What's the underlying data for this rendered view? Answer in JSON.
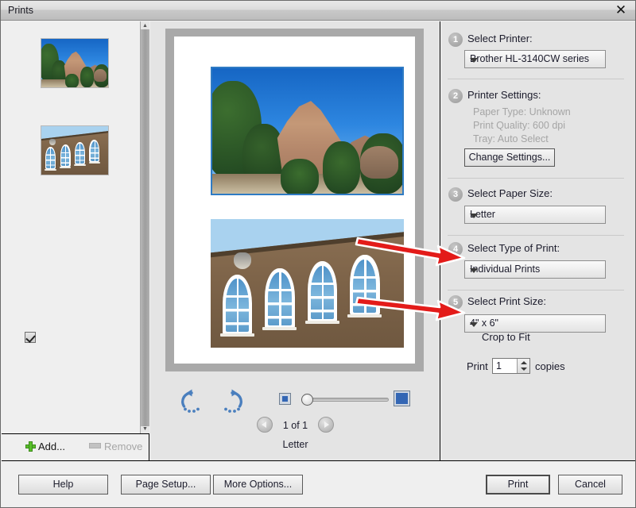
{
  "window": {
    "title": "Prints",
    "close_icon": "close-icon"
  },
  "thumbnails": {
    "items": [
      {
        "alt": "cliff-mesa-photo"
      },
      {
        "alt": "adobe-building-photo"
      }
    ],
    "add_label": "Add...",
    "remove_label": "Remove"
  },
  "preview": {
    "photos": [
      {
        "alt": "cliff-mesa-photo",
        "selected": true
      },
      {
        "alt": "adobe-building-photo",
        "selected": false
      }
    ],
    "rotate_left_icon": "rotate-left-icon",
    "rotate_right_icon": "rotate-right-icon",
    "zoom_out_icon": "zoom-small-icon",
    "zoom_in_icon": "zoom-large-icon",
    "page_indicator": "1 of 1",
    "paper_label": "Letter",
    "prev_icon": "chevron-left-icon",
    "next_icon": "chevron-right-icon"
  },
  "settings": {
    "step1": {
      "number": "1",
      "label": "Select Printer:",
      "value": "Brother HL-3140CW series"
    },
    "step2": {
      "number": "2",
      "label": "Printer Settings:",
      "paper_type": "Paper Type: Unknown",
      "print_quality": "Print Quality: 600 dpi",
      "tray": "Tray: Auto Select",
      "change_button": "Change Settings..."
    },
    "step3": {
      "number": "3",
      "label": "Select Paper Size:",
      "value": "Letter"
    },
    "step4": {
      "number": "4",
      "label": "Select Type of Print:",
      "value": "Individual Prints"
    },
    "step5": {
      "number": "5",
      "label": "Select Print Size:",
      "value": "4\" x 6\"",
      "crop_label": "Crop to Fit",
      "crop_checked": true,
      "print_prefix": "Print",
      "copies_value": "1",
      "copies_suffix": "copies"
    }
  },
  "buttons": {
    "help": "Help",
    "page_setup": "Page Setup...",
    "more_options": "More Options...",
    "print": "Print",
    "cancel": "Cancel"
  },
  "annotations": {
    "arrow_color": "#e31b19",
    "arrows": [
      {
        "name": "arrow-to-type-of-print",
        "target": "Select Type of Print dropdown"
      },
      {
        "name": "arrow-to-print-size",
        "target": "Select Print Size dropdown"
      }
    ]
  }
}
